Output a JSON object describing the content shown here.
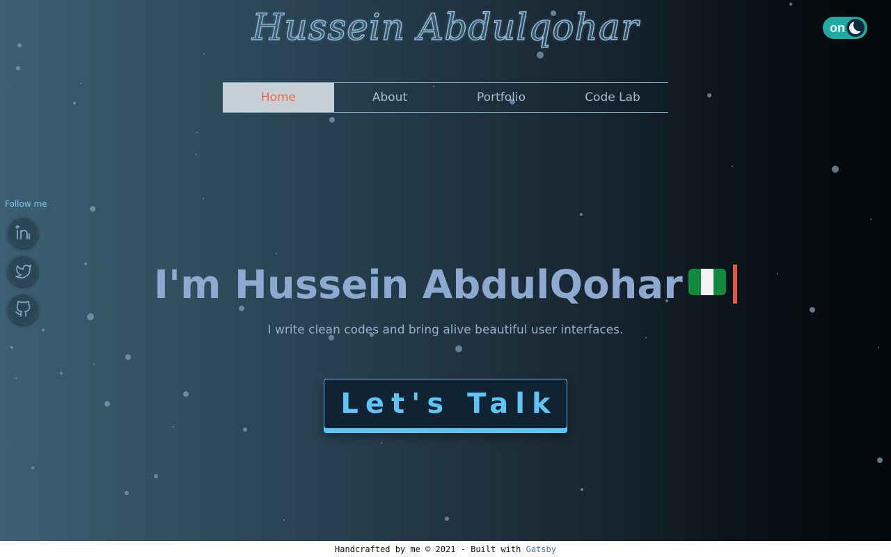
{
  "header": {
    "logo_text": "Hussein Abdulqohar",
    "theme_toggle_label": "on"
  },
  "nav": {
    "items": [
      {
        "label": "Home",
        "active": true
      },
      {
        "label": "About",
        "active": false
      },
      {
        "label": "Portfolio",
        "active": false
      },
      {
        "label": "Code Lab",
        "active": false
      }
    ]
  },
  "social": {
    "heading": "Follow me",
    "links": [
      {
        "icon": "linkedin-icon"
      },
      {
        "icon": "twitter-icon"
      },
      {
        "icon": "github-icon"
      }
    ]
  },
  "hero": {
    "title": "I'm Hussein AbdulQohar",
    "flag": "nigeria-flag-icon",
    "subtitle": "I write clean codes and bring alive beautiful user interfaces.",
    "cta_label": "Let's Talk"
  },
  "footer": {
    "text": "Handcrafted by me © 2021 - Built with ",
    "link_text": "Gatsby"
  },
  "colors": {
    "accent": "#f0694a",
    "cta": "#5ec3f5",
    "toggle": "#1fa9a0"
  }
}
